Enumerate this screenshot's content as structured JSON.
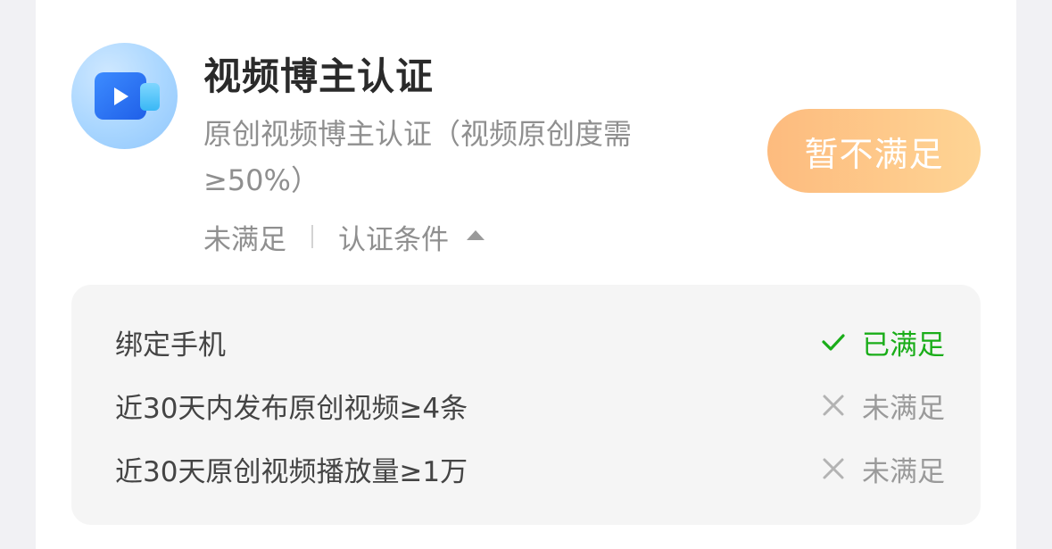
{
  "card": {
    "title": "视频博主认证",
    "description": "原创视频博主认证（视频原创度需≥50%）",
    "status_text": "未满足",
    "conditions_toggle_label": "认证条件",
    "action_button_label": "暂不满足",
    "icon": "video-camera-icon",
    "action_button_color": "#fec58a"
  },
  "conditions": [
    {
      "label": "绑定手机",
      "status": "已满足",
      "status_icon": "check-icon",
      "status_color": "#1aad19"
    },
    {
      "label": "近30天内发布原创视频≥4条",
      "status": "未满足",
      "status_icon": "cross-icon",
      "status_color": "#9a9a9a"
    },
    {
      "label": "近30天原创视频播放量≥1万",
      "status": "未满足",
      "status_icon": "cross-icon",
      "status_color": "#9a9a9a"
    }
  ]
}
